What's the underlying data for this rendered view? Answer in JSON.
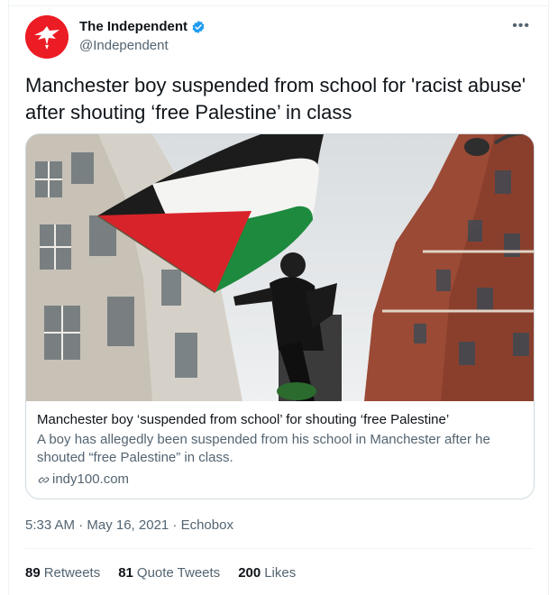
{
  "account": {
    "display_name": "The Independent",
    "handle": "@Independent"
  },
  "tweet": {
    "text": "Manchester boy suspended from school for 'racist abuse' after shouting ‘free Palestine’ in class",
    "timestamp": "5:33 AM · May 16, 2021 · Echobox"
  },
  "link_card": {
    "title": "Manchester boy ‘suspended from school’ for shouting ‘free Palestine’",
    "description": "A boy has allegedly been suspended from his school in Manchester after he shouted “free Palestine” in class.",
    "domain": "indy100.com"
  },
  "stats": {
    "retweets_count": "89",
    "retweets_label": "Retweets",
    "quotes_count": "81",
    "quotes_label": "Quote Tweets",
    "likes_count": "200",
    "likes_label": "Likes"
  },
  "icons": {
    "verified": "verified-badge-icon",
    "more": "more-options-icon",
    "link": "link-icon"
  },
  "colors": {
    "brand_red": "#ec1c24",
    "verified_blue": "#1d9bf0",
    "secondary_text": "#536471"
  }
}
